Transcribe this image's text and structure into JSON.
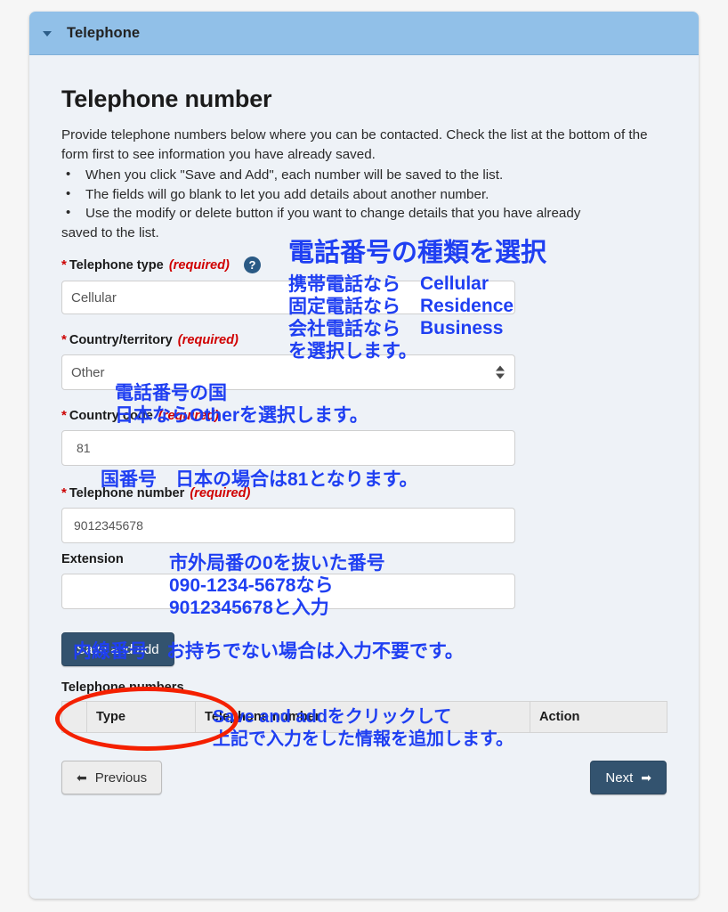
{
  "panel": {
    "header_title": "Telephone",
    "collapse_icon": "caret-down-icon"
  },
  "page": {
    "heading": "Telephone number",
    "intro": "Provide telephone numbers below where you can be contacted. Check the list at the bottom of the form first to see information you have already saved.",
    "bullets": [
      "When you click \"Save and Add\", each number will be saved to the list.",
      "The fields will go blank to let you add details about another number.",
      "Use the modify or delete button if you want to change details that you have already"
    ],
    "bullet_tail": "saved to the list."
  },
  "form": {
    "required_marker": "*",
    "required_text": "(required)",
    "help_icon": "question-mark-icon",
    "telephone_type": {
      "label": "Telephone type",
      "value": "Cellular"
    },
    "country_territory": {
      "label": "Country/territory",
      "value": "Other"
    },
    "country_code": {
      "label": "Country code",
      "value": "81"
    },
    "telephone_number": {
      "label": "Telephone number",
      "value": "9012345678"
    },
    "extension": {
      "label": "Extension",
      "value": ""
    },
    "save_and_add_label": "Save and add"
  },
  "annotations": {
    "type_title": "電話番号の種類を選択",
    "type_line1_jp": "携帯電話なら",
    "type_line1_en": "Cellular",
    "type_line2_jp": "固定電話なら",
    "type_line2_en": "Residence",
    "type_line3_jp": "会社電話なら",
    "type_line3_en": "Business",
    "type_line4": "を選択します。",
    "country_line1": "電話番号の国",
    "country_line2": "日本ならOtherを選択します。",
    "country_code_line": "国番号　日本の場合は81となります。",
    "tel_line1": "市外局番の0を抜いた番号",
    "tel_line2": "090-1234-5678なら",
    "tel_line3": "9012345678と入力",
    "extension_line": "内線番号　お持ちでない場合は入力不要です。",
    "save_line1": "Save and addをクリックして",
    "save_line2": "上記で入力をした情報を追加します。"
  },
  "table": {
    "caption": "Telephone numbers",
    "columns": [
      "",
      "Type",
      "Telephone number",
      "Action"
    ],
    "rows": []
  },
  "footer": {
    "previous_label": "Previous",
    "previous_icon": "arrow-left-icon",
    "next_label": "Next",
    "next_icon": "arrow-right-icon"
  },
  "colors": {
    "panel_header": "#91c0e8",
    "panel_body": "#eef2f7",
    "annotation_blue": "#1f3ff2",
    "required_red": "#cc0000",
    "highlight_red": "#f42000",
    "primary_button": "#33536f"
  }
}
